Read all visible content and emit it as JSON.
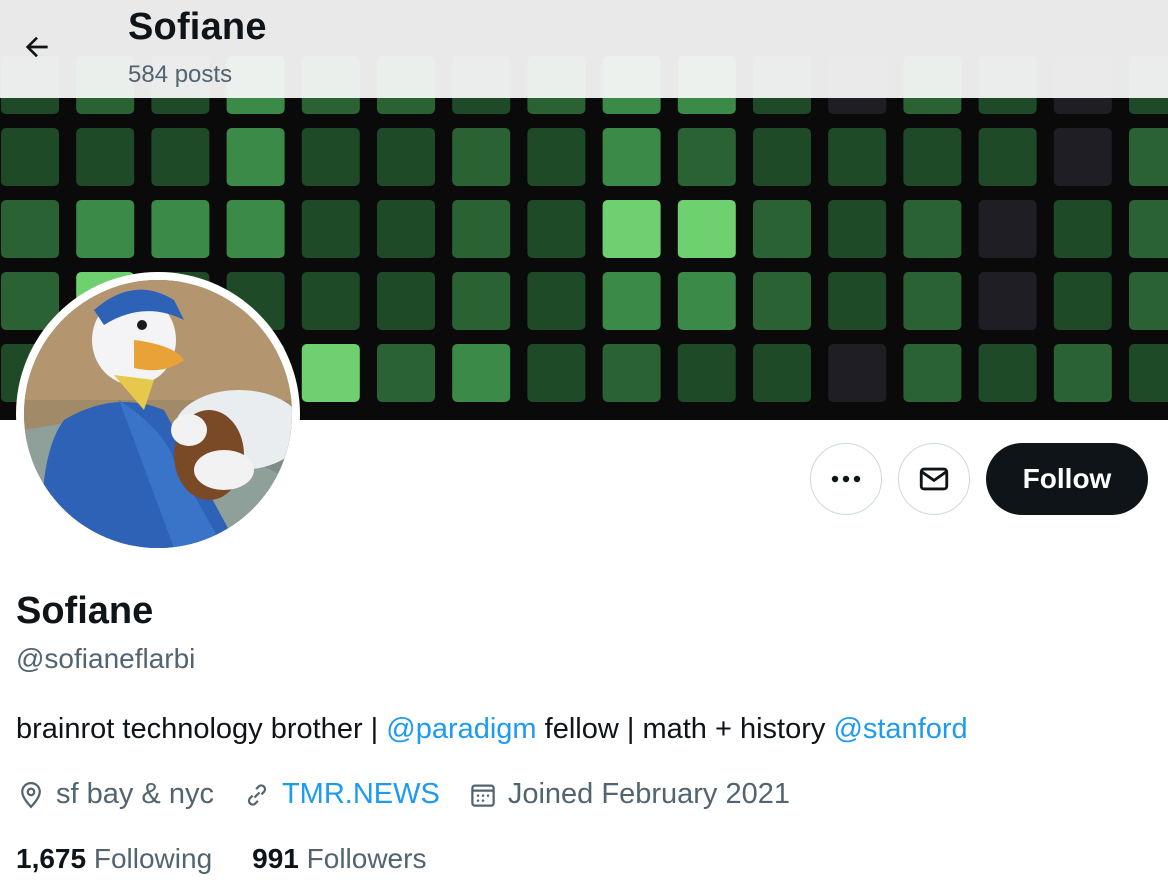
{
  "header": {
    "title": "Sofiane",
    "posts_count": "584 posts"
  },
  "banner": {
    "description_colors": [
      "#1f4a27",
      "#2a6234",
      "#3b8a48",
      "#6fd06f",
      "#1e1e24"
    ]
  },
  "actions": {
    "more_icon": "more-horizontal-icon",
    "message_icon": "envelope-icon",
    "follow_label": "Follow"
  },
  "profile": {
    "name": "Sofiane",
    "handle": "@sofianeflarbi",
    "bio": {
      "part1": "brainrot technology brother | ",
      "mention1": "@paradigm",
      "part2": " fellow | math + history ",
      "mention2": "@stanford"
    },
    "location": "sf bay & nyc",
    "website": "TMR.NEWS",
    "joined": "Joined February 2021"
  },
  "stats": {
    "following_count": "1,675",
    "following_label": "Following",
    "followers_count": "991",
    "followers_label": "Followers"
  },
  "colors": {
    "accent": "#1d9bf0",
    "text_primary": "#0f1419",
    "text_secondary": "#536471"
  }
}
